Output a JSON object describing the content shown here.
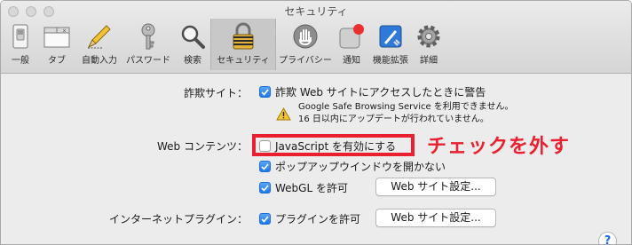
{
  "window": {
    "title": "セキュリティ"
  },
  "toolbar": {
    "items": [
      {
        "label": "一般",
        "icon": "general-switch-icon"
      },
      {
        "label": "タブ",
        "icon": "tabs-icon"
      },
      {
        "label": "自動入力",
        "icon": "pencil-icon"
      },
      {
        "label": "パスワード",
        "icon": "key-icon"
      },
      {
        "label": "検索",
        "icon": "magnifier-icon"
      },
      {
        "label": "セキュリティ",
        "icon": "padlock-icon",
        "selected": true
      },
      {
        "label": "プライバシー",
        "icon": "hand-icon"
      },
      {
        "label": "通知",
        "icon": "notification-badge-icon"
      },
      {
        "label": "機能拡張",
        "icon": "puzzle-icon"
      },
      {
        "label": "詳細",
        "icon": "gear-icon"
      }
    ]
  },
  "fraud": {
    "label": "詐欺サイト：",
    "checkbox_label": "詐欺 Web サイトにアクセスしたときに警告",
    "checked": true,
    "warning_line1": "Google Safe Browsing Service を利用できません。",
    "warning_line2": "16 日以内にアップデートが行われていません。"
  },
  "web_content": {
    "label": "Web コンテンツ：",
    "javascript_label": "JavaScript を有効にする",
    "javascript_checked": false,
    "popups_label": "ポップアップウインドウを開かない",
    "popups_checked": true,
    "webgl_label": "WebGL を許可",
    "webgl_checked": true,
    "webgl_button": "Web サイト設定..."
  },
  "plugins": {
    "label": "インターネットプラグイン：",
    "checkbox_label": "プラグインを許可",
    "checked": true,
    "button": "Web サイト設定..."
  },
  "annotation": {
    "callout_text": "チェックを外す",
    "color": "#e8202f"
  },
  "help": {
    "label": "?"
  },
  "colors": {
    "accent": "#1d78ea",
    "highlight": "#e8202f"
  }
}
